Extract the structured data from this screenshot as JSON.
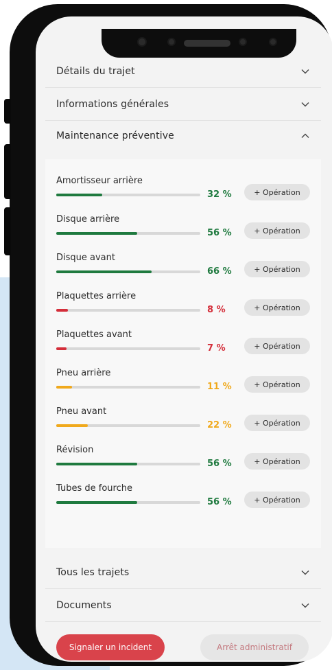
{
  "sections": {
    "trip_details": "Détails du trajet",
    "general_info": "Informations générales",
    "preventive_maintenance": "Maintenance préventive",
    "all_trips": "Tous les trajets",
    "documents": "Documents"
  },
  "maintenance": {
    "operation_label": "+ Opération",
    "items": [
      {
        "label": "Amortisseur arrière",
        "percent": 32,
        "percent_text": "32 %",
        "color": "#1f7a3f"
      },
      {
        "label": "Disque arrière",
        "percent": 56,
        "percent_text": "56 %",
        "color": "#1f7a3f"
      },
      {
        "label": "Disque avant",
        "percent": 66,
        "percent_text": "66 %",
        "color": "#1f7a3f"
      },
      {
        "label": "Plaquettes arrière",
        "percent": 8,
        "percent_text": "8 %",
        "color": "#d42e3a"
      },
      {
        "label": "Plaquettes avant",
        "percent": 7,
        "percent_text": "7 %",
        "color": "#d42e3a"
      },
      {
        "label": "Pneu arrière",
        "percent": 11,
        "percent_text": "11 %",
        "color": "#f0a91c"
      },
      {
        "label": "Pneu avant",
        "percent": 22,
        "percent_text": "22 %",
        "color": "#f0a91c"
      },
      {
        "label": "Révision",
        "percent": 56,
        "percent_text": "56 %",
        "color": "#1f7a3f"
      },
      {
        "label": "Tubes de fourche",
        "percent": 56,
        "percent_text": "56 %",
        "color": "#1f7a3f"
      }
    ]
  },
  "actions": {
    "report_incident": "Signaler un incident",
    "administrative_stop": "Arrêt administratif"
  },
  "colors": {
    "good": "#1f7a3f",
    "warning": "#f0a91c",
    "danger": "#d42e3a",
    "primary_button": "#d9434b",
    "disabled_button": "#e6e6e6"
  },
  "icons": {
    "collapsed": "chevron-down-icon",
    "expanded": "chevron-up-icon"
  }
}
